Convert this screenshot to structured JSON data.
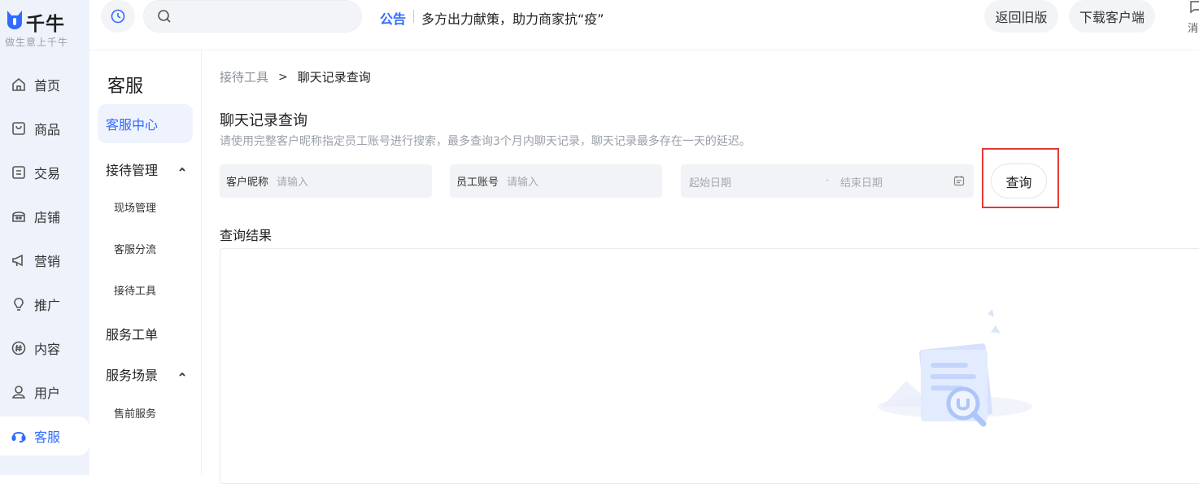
{
  "brand": {
    "name": "千牛",
    "slogan": "做生意上千牛",
    "accent": "#2f6bff"
  },
  "nav": {
    "items": [
      {
        "label": "首页",
        "icon": "home-icon"
      },
      {
        "label": "商品",
        "icon": "bag-icon"
      },
      {
        "label": "交易",
        "icon": "order-icon"
      },
      {
        "label": "店铺",
        "icon": "store-icon"
      },
      {
        "label": "营销",
        "icon": "megaphone-icon"
      },
      {
        "label": "推广",
        "icon": "bulb-icon"
      },
      {
        "label": "内容",
        "icon": "hash-icon"
      },
      {
        "label": "用户",
        "icon": "user-icon"
      },
      {
        "label": "客服",
        "icon": "headset-icon",
        "active": true
      }
    ]
  },
  "topbar": {
    "search_placeholder": "",
    "notice_tag": "公告",
    "notice_text": "多方出力献策，助力商家抗“疫”",
    "old_version_label": "返回旧版",
    "download_label": "下载客户端",
    "message_label": "消"
  },
  "subnav": {
    "title": "客服",
    "active_item": "客服中心",
    "groups": [
      {
        "label": "接待管理",
        "items": [
          "现场管理",
          "客服分流",
          "接待工具"
        ]
      },
      {
        "label": "服务工单",
        "items": []
      },
      {
        "label": "服务场景",
        "items": [
          "售前服务"
        ]
      }
    ]
  },
  "main": {
    "breadcrumb": {
      "parent": "接待工具",
      "separator": ">",
      "current": "聊天记录查询"
    },
    "title": "聊天记录查询",
    "description": "请使用完整客户昵称指定员工账号进行搜索，最多查询3个月内聊天记录，聊天记录最多存在一天的延迟。",
    "filters": {
      "nickname": {
        "label": "客户昵称",
        "placeholder": "请输入"
      },
      "staff_account": {
        "label": "员工账号",
        "placeholder": "请输入"
      },
      "date_range": {
        "start_placeholder": "起始日期",
        "separator": "-",
        "end_placeholder": "结束日期"
      }
    },
    "query_label": "查询",
    "result_title": "查询结果"
  }
}
